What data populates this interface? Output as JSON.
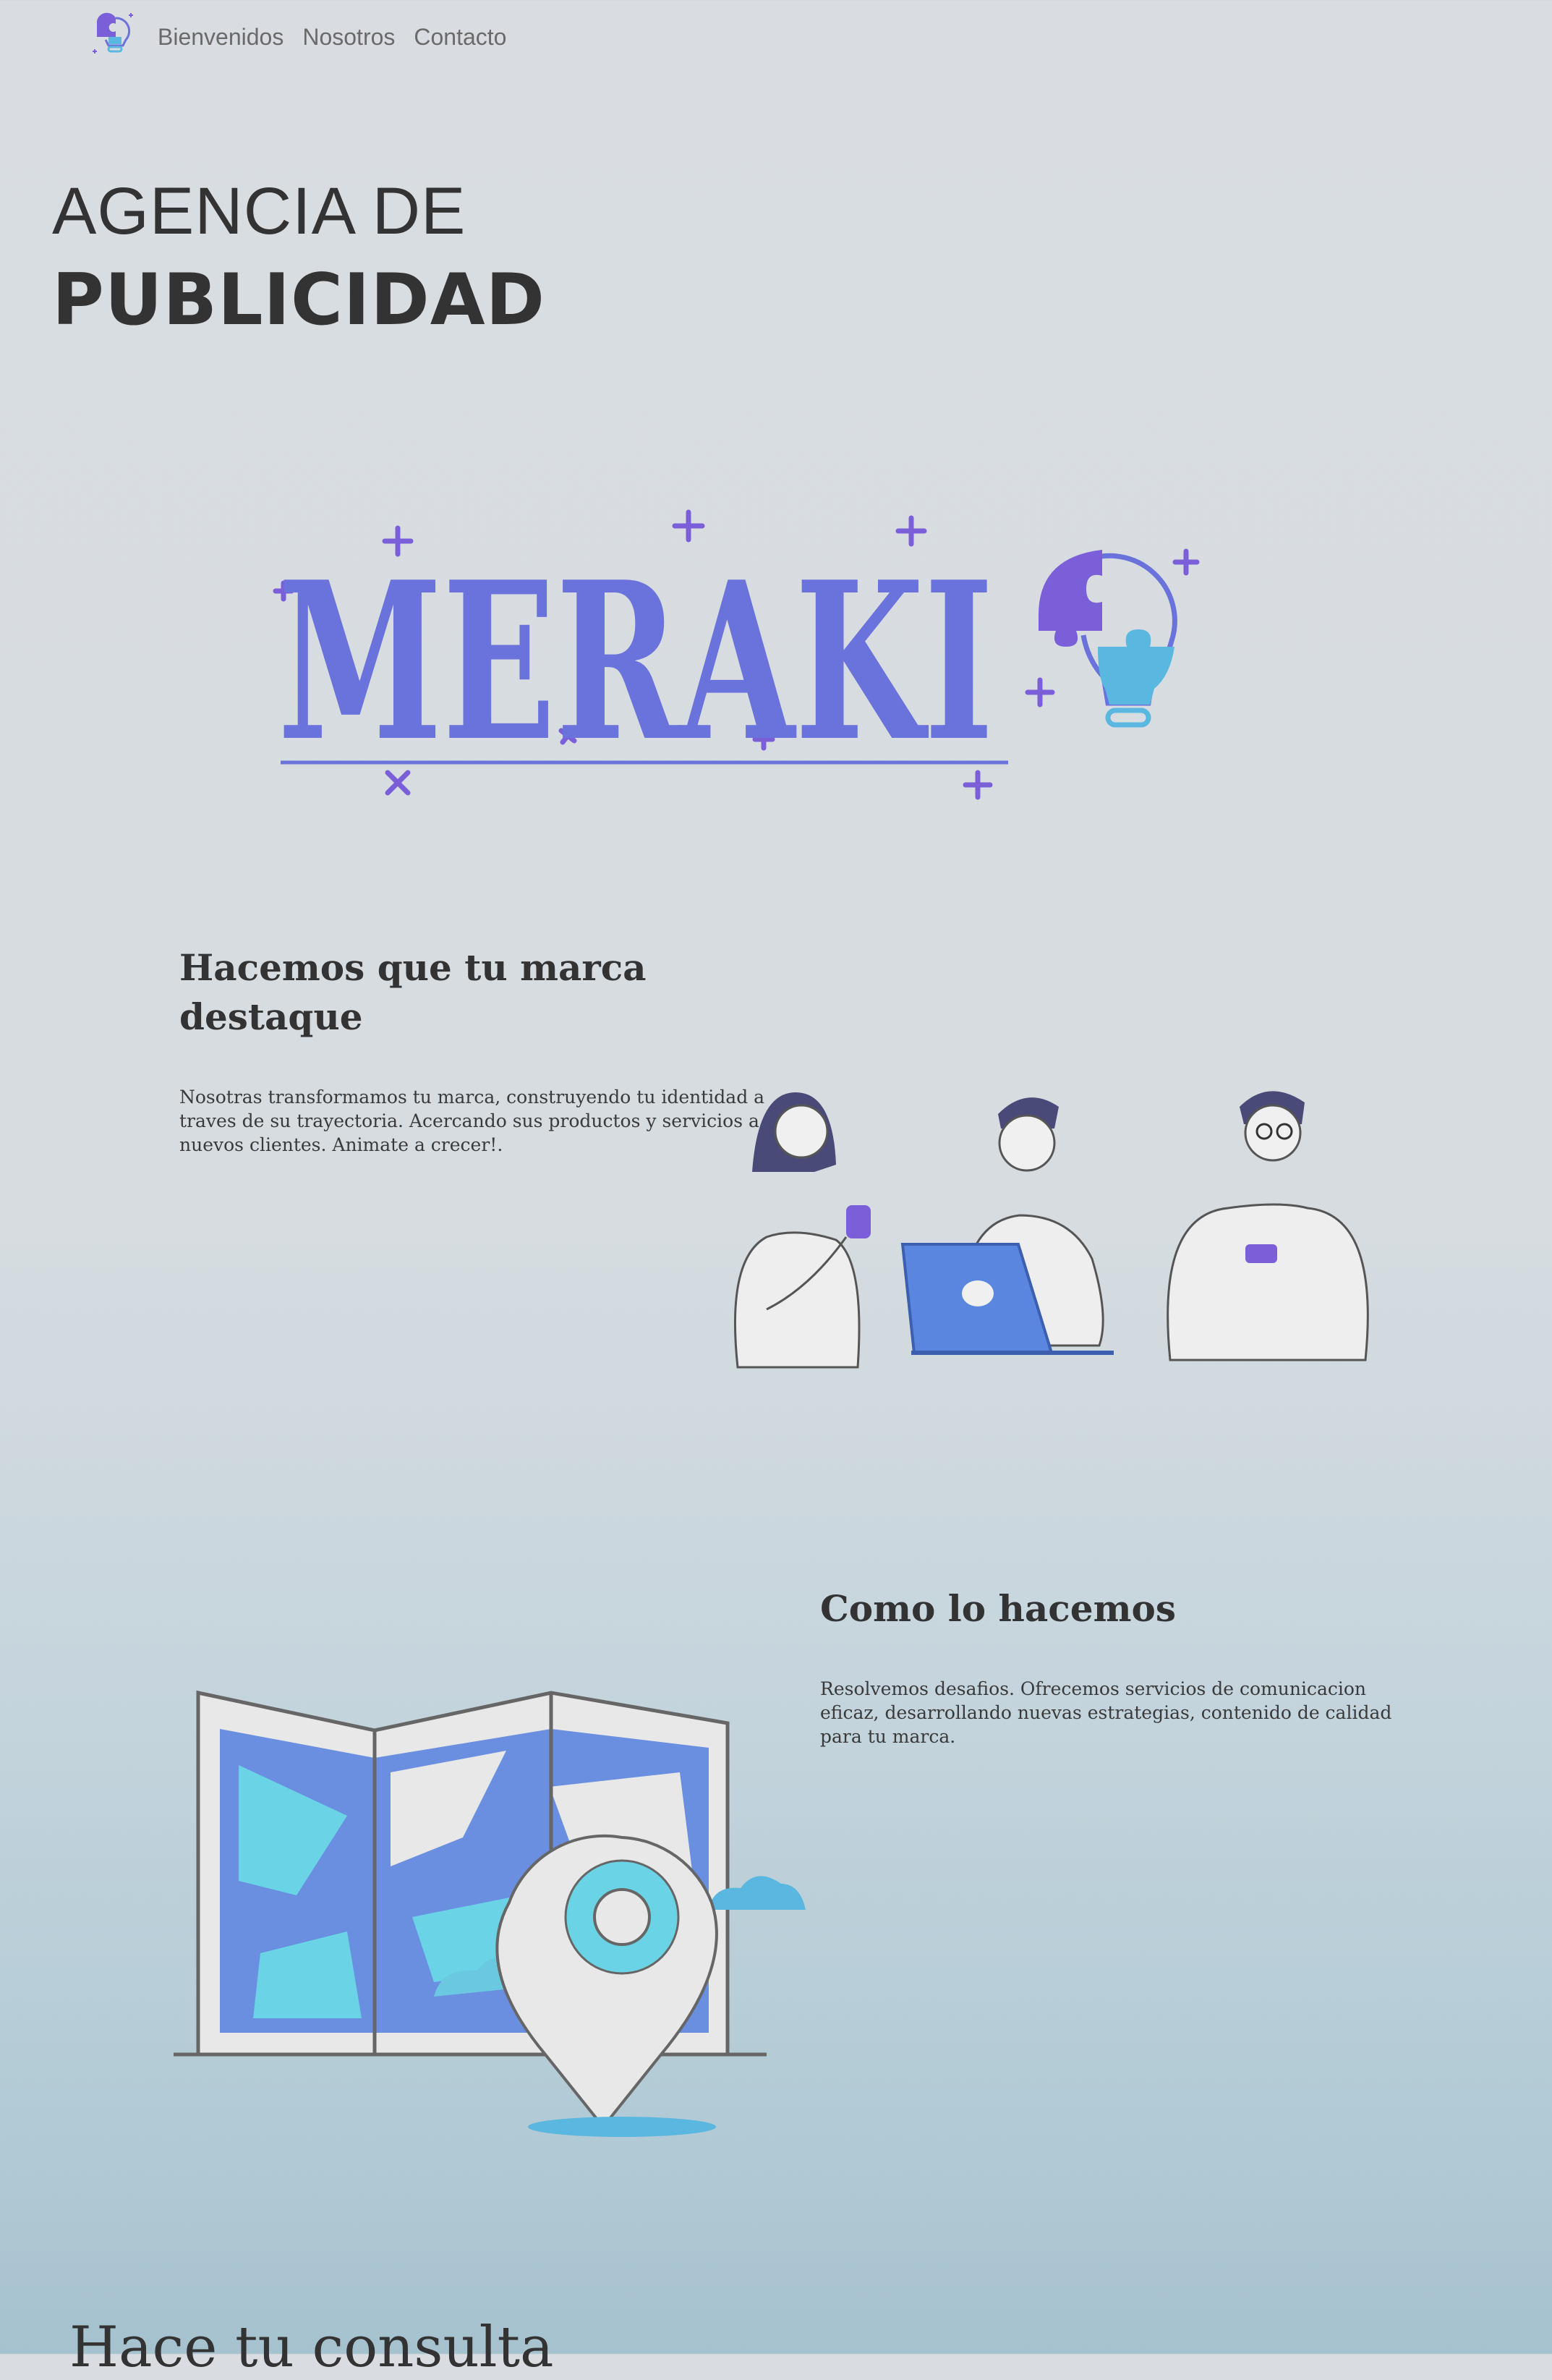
{
  "nav": {
    "items": [
      "Bienvenidos",
      "Nosotros",
      "Contacto"
    ]
  },
  "hero": {
    "line1": "AGENCIA DE",
    "line2": "PUBLICIDAD"
  },
  "brand": {
    "logo_text": "MERAKI",
    "icon": "puzzle-lightbulb-icon",
    "colors": {
      "primary": "#6a72db",
      "purple": "#7b5fd8",
      "cyan": "#59b7e0"
    }
  },
  "section1": {
    "title_line1": "Hacemos que tu marca",
    "title_line2": "destaque",
    "body_lines": [
      "Nosotras transformamos tu marca, construyendo tu identidad a",
      "traves de su trayectoria. Acercando sus productos y servicios a",
      "nuevos clientes. Animate a crecer!."
    ]
  },
  "section2": {
    "title": "Como lo hacemos",
    "body_lines": [
      "Resolvemos desafios. Ofrecemos servicios de comunicacion",
      "eficaz, desarrollando nuevas estrategias, contenido de calidad",
      "para tu marca."
    ]
  },
  "contact": {
    "title": "Hace tu consulta"
  }
}
